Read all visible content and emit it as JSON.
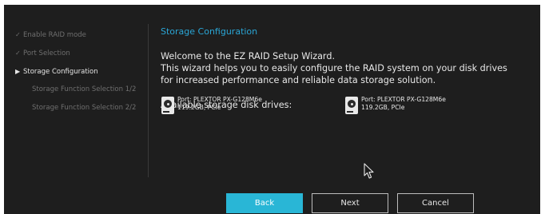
{
  "sidebar": {
    "steps": [
      {
        "label": "Enable RAID mode",
        "mark": "✓",
        "state": "done"
      },
      {
        "label": "Port Selection",
        "mark": "✓",
        "state": "done"
      },
      {
        "label": "Storage Configuration",
        "mark": "▶",
        "state": "active"
      },
      {
        "label": "Storage Function Selection 1/2",
        "mark": "",
        "state": "pending"
      },
      {
        "label": "Storage Function Selection 2/2",
        "mark": "",
        "state": "pending"
      }
    ]
  },
  "main": {
    "title": "Storage Configuration",
    "welcome_line1": "Welcome to the EZ RAID Setup Wizard.",
    "welcome_line2": "This wizard helps you to easily configure the RAID system on your disk drives",
    "welcome_line3": "for increased performance and reliable data storage solution.",
    "drives_heading": "Available storage disk drives:",
    "drives": [
      {
        "port": "Port: PLEXTOR PX-G128M6e",
        "details": "119.2GB, PCIe",
        "icon": "hard-disk-icon"
      },
      {
        "port": "Port: PLEXTOR PX-G128M6e",
        "details": "119.2GB, PCIe",
        "icon": "hard-disk-icon"
      }
    ]
  },
  "buttons": {
    "back": "Back",
    "next": "Next",
    "cancel": "Cancel"
  },
  "colors": {
    "accent": "#2aa6d6",
    "primary_button": "#29b6d6",
    "background": "#1e1e1e",
    "done_step_text": "#6f6f6f",
    "active_step_text": "#e6e6e6"
  }
}
